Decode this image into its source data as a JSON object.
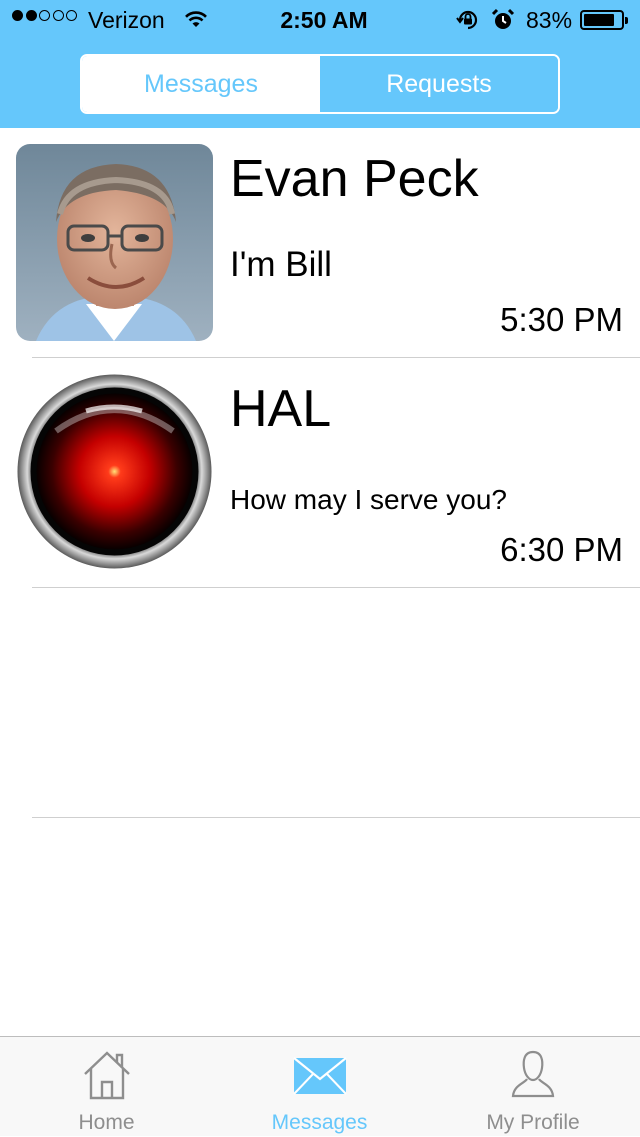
{
  "status_bar": {
    "carrier": "Verizon",
    "signal_bars_filled": 2,
    "signal_bars_total": 5,
    "time": "2:50 AM",
    "battery_percent": "83%",
    "battery_level": 0.83
  },
  "segmented_control": {
    "messages_label": "Messages",
    "requests_label": "Requests",
    "selected": "Messages"
  },
  "conversations": [
    {
      "name": "Evan Peck",
      "preview": "I'm Bill",
      "time": "5:30 PM"
    },
    {
      "name": "HAL",
      "preview": "How may I serve you?",
      "time": "6:30 PM"
    }
  ],
  "tab_bar": {
    "home_label": "Home",
    "messages_label": "Messages",
    "profile_label": "My Profile",
    "selected": "Messages"
  },
  "colors": {
    "accent": "#65c7fb",
    "inactive_tab": "#8e8e8e",
    "separator": "#cfcfcf"
  }
}
